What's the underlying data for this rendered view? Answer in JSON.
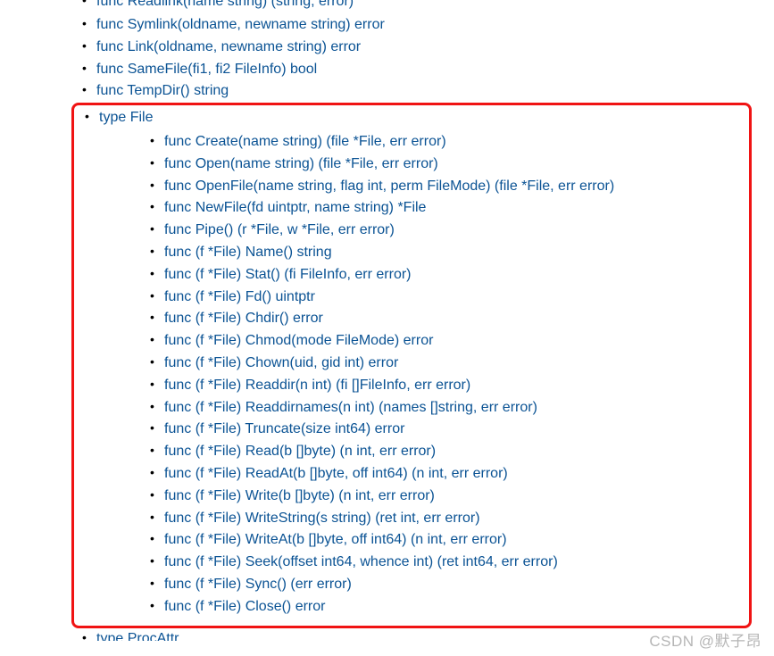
{
  "topItems": [
    "func Readlink(name string) (string, error)",
    "func Symlink(oldname, newname string) error",
    "func Link(oldname, newname string) error",
    "func SameFile(fi1, fi2 FileInfo) bool",
    "func TempDir() string"
  ],
  "boxed": {
    "typeLabel": "type File",
    "methods": [
      "func Create(name string) (file *File, err error)",
      "func Open(name string) (file *File, err error)",
      "func OpenFile(name string, flag int, perm FileMode) (file *File, err error)",
      "func NewFile(fd uintptr, name string) *File",
      "func Pipe() (r *File, w *File, err error)",
      "func (f *File) Name() string",
      "func (f *File) Stat() (fi FileInfo, err error)",
      "func (f *File) Fd() uintptr",
      "func (f *File) Chdir() error",
      "func (f *File) Chmod(mode FileMode) error",
      "func (f *File) Chown(uid, gid int) error",
      "func (f *File) Readdir(n int) (fi []FileInfo, err error)",
      "func (f *File) Readdirnames(n int) (names []string, err error)",
      "func (f *File) Truncate(size int64) error",
      "func (f *File) Read(b []byte) (n int, err error)",
      "func (f *File) ReadAt(b []byte, off int64) (n int, err error)",
      "func (f *File) Write(b []byte) (n int, err error)",
      "func (f *File) WriteString(s string) (ret int, err error)",
      "func (f *File) WriteAt(b []byte, off int64) (n int, err error)",
      "func (f *File) Seek(offset int64, whence int) (ret int64, err error)",
      "func (f *File) Sync() (err error)",
      "func (f *File) Close() error"
    ]
  },
  "bottomItem": "type ProcAttr",
  "watermark": "CSDN @默子昂"
}
